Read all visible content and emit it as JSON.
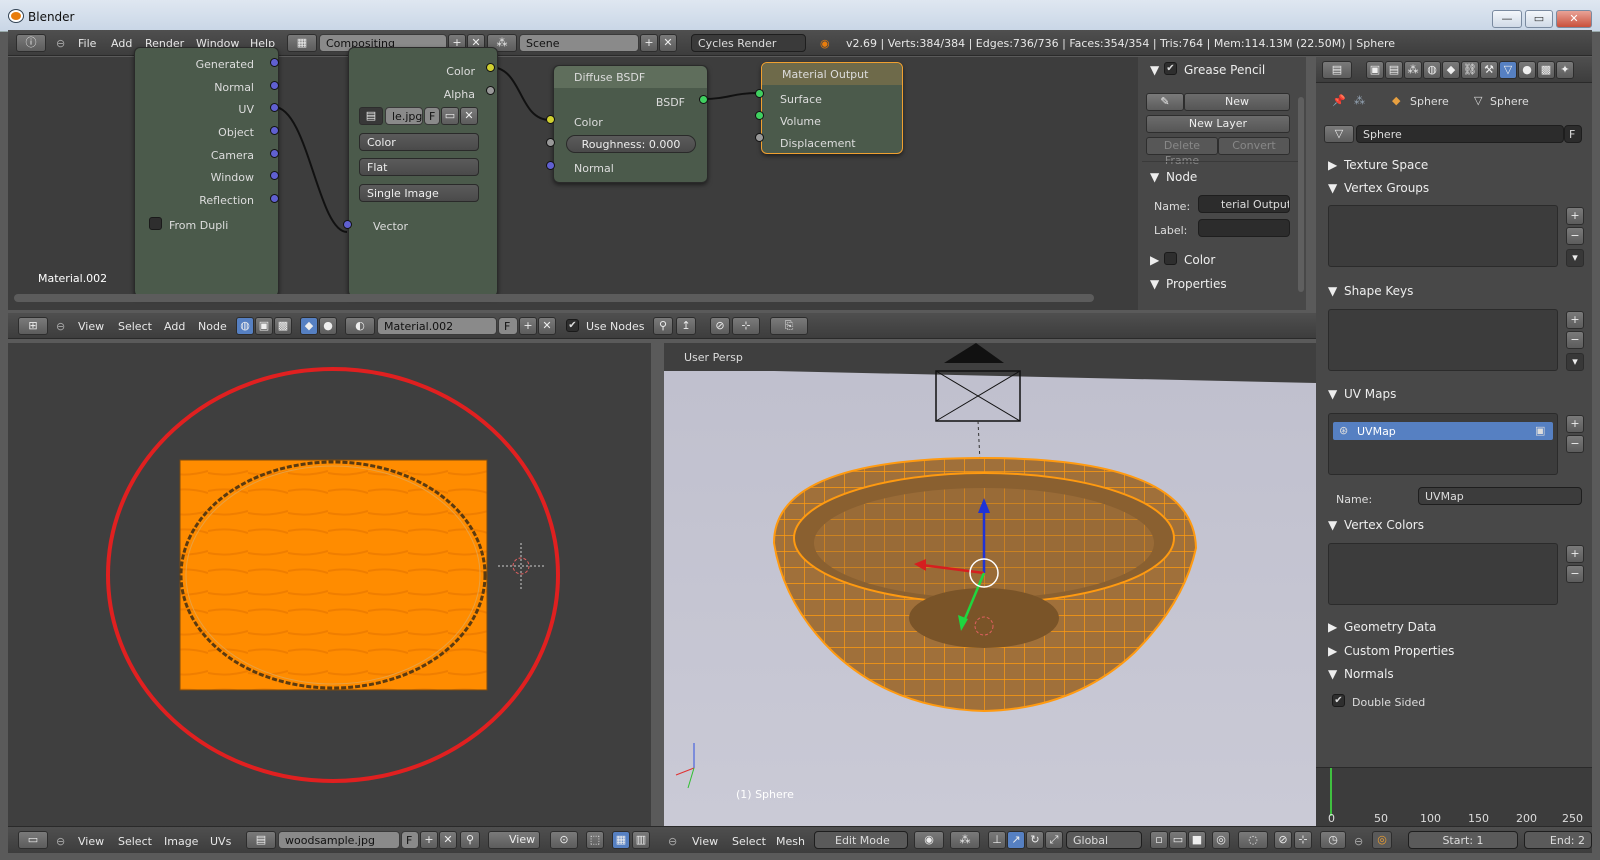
{
  "window": {
    "title": "Blender"
  },
  "info_header": {
    "menus": [
      "File",
      "Add",
      "Render",
      "Window",
      "Help"
    ],
    "screen": "Compositing",
    "scene": "Scene",
    "engine": "Cycles Render",
    "stats": "v2.69 | Verts:384/384 | Edges:736/736 | Faces:354/354 | Tris:764 | Mem:114.13M (22.50M) | Sphere"
  },
  "node_editor": {
    "material_label": "Material.002",
    "texcoord_outputs": [
      "Generated",
      "Normal",
      "UV",
      "Object",
      "Camera",
      "Window",
      "Reflection"
    ],
    "from_dupli": "From Dupli",
    "image_tex": {
      "out_color": "Color",
      "out_alpha": "Alpha",
      "file": "le.jpg",
      "f": "F",
      "color": "Color",
      "interp": "Flat",
      "proj": "Single Image",
      "in_vector": "Vector"
    },
    "diffuse": {
      "title": "Diffuse BSDF",
      "out": "BSDF",
      "color": "Color",
      "roughness": "Roughness: 0.000",
      "normal": "Normal"
    },
    "output": {
      "title": "Material Output",
      "surface": "Surface",
      "volume": "Volume",
      "displacement": "Displacement"
    },
    "header": {
      "menus": [
        "View",
        "Select",
        "Add",
        "Node"
      ],
      "material": "Material.002",
      "f": "F",
      "use_nodes": "Use Nodes"
    }
  },
  "sidebar": {
    "grease_pencil": "Grease Pencil",
    "new": "New",
    "new_layer": "New Layer",
    "delete_frame": "Delete Frame",
    "convert": "Convert",
    "node": "Node",
    "name_label": "Name:",
    "name_value": "terial Output",
    "label_label": "Label:",
    "color": "Color",
    "properties": "Properties"
  },
  "properties": {
    "breadcrumb1": "Sphere",
    "breadcrumb2": "Sphere",
    "mesh_name": "Sphere",
    "f": "F",
    "sections": {
      "texture_space": "Texture Space",
      "vertex_groups": "Vertex Groups",
      "shape_keys": "Shape Keys",
      "uv_maps": "UV Maps",
      "vertex_colors": "Vertex Colors",
      "geometry_data": "Geometry Data",
      "custom_properties": "Custom Properties",
      "normals": "Normals"
    },
    "uvmap_item": "UVMap",
    "name_label": "Name:",
    "uvmap_name": "UVMap",
    "double_sided": "Double Sided"
  },
  "uv_editor": {
    "menus": [
      "View",
      "Select",
      "Image",
      "UVs"
    ],
    "image": "woodsample.jpg",
    "f": "F",
    "view": "View"
  },
  "viewport": {
    "persp": "User Persp",
    "object": "(1) Sphere",
    "menus": [
      "View",
      "Select",
      "Mesh"
    ],
    "mode": "Edit Mode",
    "orientation": "Global"
  },
  "timeline": {
    "ticks": [
      "0",
      "50",
      "100",
      "150",
      "200",
      "250"
    ],
    "start": "Start: 1",
    "end": "End: 2"
  },
  "colors": {
    "orange": "#ff8c00",
    "red_circle": "#e02020",
    "selected": "#5680c2"
  }
}
